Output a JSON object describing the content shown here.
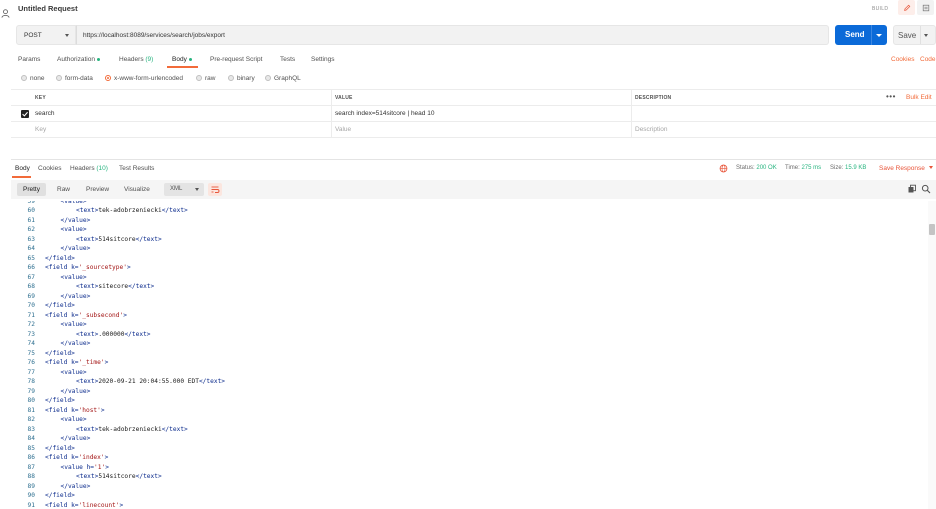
{
  "window": {
    "title": "Untitled Request",
    "build_label": "BUILD"
  },
  "request": {
    "method": "POST",
    "url": "https://localhost:8089/services/search/jobs/export",
    "send_label": "Send",
    "save_label": "Save"
  },
  "tabs": [
    {
      "label": "Params"
    },
    {
      "label": "Authorization"
    },
    {
      "label": "Headers",
      "count": "(9)"
    },
    {
      "label": "Body"
    },
    {
      "label": "Pre-request Script"
    },
    {
      "label": "Tests"
    },
    {
      "label": "Settings"
    }
  ],
  "links": {
    "cookies": "Cookies",
    "code": "Code"
  },
  "body_types": [
    "none",
    "form-data",
    "x-www-form-urlencoded",
    "raw",
    "binary",
    "GraphQL"
  ],
  "body_type_selected": "x-www-form-urlencoded",
  "params_table": {
    "headers": {
      "key": "KEY",
      "value": "VALUE",
      "description": "DESCRIPTION"
    },
    "bulk_edit": "Bulk Edit",
    "rows": [
      {
        "key": "search",
        "value": "search index=514sitcore | head 10",
        "description": "",
        "checked": true
      }
    ],
    "placeholder": {
      "key": "Key",
      "value": "Value",
      "description": "Description"
    }
  },
  "response": {
    "tabs": [
      {
        "label": "Body"
      },
      {
        "label": "Cookies"
      },
      {
        "label": "Headers",
        "count": "(10)"
      },
      {
        "label": "Test Results"
      }
    ],
    "status_label": "Status:",
    "status_value": "200 OK",
    "time_label": "Time:",
    "time_value": "275 ms",
    "size_label": "Size:",
    "size_value": "15.9 KB",
    "save_response": "Save Response",
    "views": [
      "Pretty",
      "Raw",
      "Preview",
      "Visualize"
    ],
    "active_view": "Pretty",
    "format": "XML"
  },
  "code": {
    "lines": [
      {
        "n": "59",
        "indent": 2,
        "parts": [
          [
            "tag",
            "<value>"
          ]
        ]
      },
      {
        "n": "60",
        "indent": 3,
        "parts": [
          [
            "tag",
            "<text>"
          ],
          [
            "txt",
            "tek-adobrzeniecki"
          ],
          [
            "tag",
            "</text>"
          ]
        ]
      },
      {
        "n": "61",
        "indent": 2,
        "parts": [
          [
            "tag",
            "</value>"
          ]
        ]
      },
      {
        "n": "62",
        "indent": 2,
        "parts": [
          [
            "tag",
            "<value>"
          ]
        ]
      },
      {
        "n": "63",
        "indent": 3,
        "parts": [
          [
            "tag",
            "<text>"
          ],
          [
            "txt",
            "514sitcore"
          ],
          [
            "tag",
            "</text>"
          ]
        ]
      },
      {
        "n": "64",
        "indent": 2,
        "parts": [
          [
            "tag",
            "</value>"
          ]
        ]
      },
      {
        "n": "65",
        "indent": 1,
        "parts": [
          [
            "tag",
            "</field>"
          ]
        ]
      },
      {
        "n": "66",
        "indent": 1,
        "parts": [
          [
            "tag",
            "<field k="
          ],
          [
            "attr",
            "'_sourcetype'"
          ],
          [
            "tag",
            ">"
          ]
        ]
      },
      {
        "n": "67",
        "indent": 2,
        "parts": [
          [
            "tag",
            "<value>"
          ]
        ]
      },
      {
        "n": "68",
        "indent": 3,
        "parts": [
          [
            "tag",
            "<text>"
          ],
          [
            "txt",
            "sitecore"
          ],
          [
            "tag",
            "</text>"
          ]
        ]
      },
      {
        "n": "69",
        "indent": 2,
        "parts": [
          [
            "tag",
            "</value>"
          ]
        ]
      },
      {
        "n": "70",
        "indent": 1,
        "parts": [
          [
            "tag",
            "</field>"
          ]
        ]
      },
      {
        "n": "71",
        "indent": 1,
        "parts": [
          [
            "tag",
            "<field k="
          ],
          [
            "attr",
            "'_subsecond'"
          ],
          [
            "tag",
            ">"
          ]
        ]
      },
      {
        "n": "72",
        "indent": 2,
        "parts": [
          [
            "tag",
            "<value>"
          ]
        ]
      },
      {
        "n": "73",
        "indent": 3,
        "parts": [
          [
            "tag",
            "<text>"
          ],
          [
            "txt",
            ".000000"
          ],
          [
            "tag",
            "</text>"
          ]
        ]
      },
      {
        "n": "74",
        "indent": 2,
        "parts": [
          [
            "tag",
            "</value>"
          ]
        ]
      },
      {
        "n": "75",
        "indent": 1,
        "parts": [
          [
            "tag",
            "</field>"
          ]
        ]
      },
      {
        "n": "76",
        "indent": 1,
        "parts": [
          [
            "tag",
            "<field k="
          ],
          [
            "attr",
            "'_time'"
          ],
          [
            "tag",
            ">"
          ]
        ]
      },
      {
        "n": "77",
        "indent": 2,
        "parts": [
          [
            "tag",
            "<value>"
          ]
        ]
      },
      {
        "n": "78",
        "indent": 3,
        "parts": [
          [
            "tag",
            "<text>"
          ],
          [
            "txt",
            "2020-09-21 20:04:55.000 EDT"
          ],
          [
            "tag",
            "</text>"
          ]
        ]
      },
      {
        "n": "79",
        "indent": 2,
        "parts": [
          [
            "tag",
            "</value>"
          ]
        ]
      },
      {
        "n": "80",
        "indent": 1,
        "parts": [
          [
            "tag",
            "</field>"
          ]
        ]
      },
      {
        "n": "81",
        "indent": 1,
        "parts": [
          [
            "tag",
            "<field k="
          ],
          [
            "attr",
            "'host'"
          ],
          [
            "tag",
            ">"
          ]
        ]
      },
      {
        "n": "82",
        "indent": 2,
        "parts": [
          [
            "tag",
            "<value>"
          ]
        ]
      },
      {
        "n": "83",
        "indent": 3,
        "parts": [
          [
            "tag",
            "<text>"
          ],
          [
            "txt",
            "tek-adobrzeniecki"
          ],
          [
            "tag",
            "</text>"
          ]
        ]
      },
      {
        "n": "84",
        "indent": 2,
        "parts": [
          [
            "tag",
            "</value>"
          ]
        ]
      },
      {
        "n": "85",
        "indent": 1,
        "parts": [
          [
            "tag",
            "</field>"
          ]
        ]
      },
      {
        "n": "86",
        "indent": 1,
        "parts": [
          [
            "tag",
            "<field k="
          ],
          [
            "attr",
            "'index'"
          ],
          [
            "tag",
            ">"
          ]
        ]
      },
      {
        "n": "87",
        "indent": 2,
        "parts": [
          [
            "tag",
            "<value h="
          ],
          [
            "attr",
            "'1'"
          ],
          [
            "tag",
            ">"
          ]
        ]
      },
      {
        "n": "88",
        "indent": 3,
        "parts": [
          [
            "tag",
            "<text>"
          ],
          [
            "txt",
            "514sitcore"
          ],
          [
            "tag",
            "</text>"
          ]
        ]
      },
      {
        "n": "89",
        "indent": 2,
        "parts": [
          [
            "tag",
            "</value>"
          ]
        ]
      },
      {
        "n": "90",
        "indent": 1,
        "parts": [
          [
            "tag",
            "</field>"
          ]
        ]
      },
      {
        "n": "91",
        "indent": 1,
        "parts": [
          [
            "tag",
            "<field k="
          ],
          [
            "attr",
            "'linecount'"
          ],
          [
            "tag",
            ">"
          ]
        ]
      }
    ]
  },
  "colors": {
    "accent": "#f26b3a",
    "send": "#0b6ad8",
    "success": "#26b47f"
  },
  "icons": [
    "user-icon",
    "edit-icon",
    "document-icon",
    "globe-icon",
    "wrap-lines-icon",
    "copy-icon",
    "search-icon"
  ]
}
